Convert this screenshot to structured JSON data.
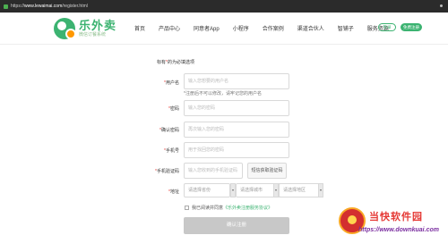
{
  "browser": {
    "url_prefix": "https://",
    "url_host": "www.lewaimai.com",
    "url_path": "/register.html"
  },
  "header": {
    "logo_name": "乐外卖",
    "logo_slogan": "微信订餐系统",
    "nav": [
      "首页",
      "产品中心",
      "同意者App",
      "小程序",
      "合作案例",
      "渠道合伙人",
      "智铺子",
      "服务资源"
    ],
    "login_label": "登录",
    "register_label": "免费注册"
  },
  "form": {
    "note_prefix": "标有",
    "note_star": "*",
    "note_suffix": "的为必填选项",
    "username": {
      "label": "用户名",
      "placeholder": "输入您想要的用户名",
      "hint": "*注册后不可以修改，请牢记您的用户名"
    },
    "password": {
      "label": "密码",
      "placeholder": "输入您的密码"
    },
    "confirm_password": {
      "label": "确认密码",
      "placeholder": "再次输入您的密码"
    },
    "phone": {
      "label": "手机号",
      "placeholder": "用于找回您的密码"
    },
    "sms_code": {
      "label": "手机验证码",
      "placeholder": "输入您收到的手机验证码",
      "button": "短信获取验证码"
    },
    "address": {
      "label": "地址",
      "province": "请选择省份",
      "city": "请选择城市",
      "district": "请选择地区"
    },
    "agree_prefix": "我已阅读并同意",
    "agree_link": "《乐外卖注册服务协议》",
    "submit_label": "确认注册"
  },
  "watermark": {
    "title": "当快软件园",
    "url": "https://www.downkuai.com"
  }
}
